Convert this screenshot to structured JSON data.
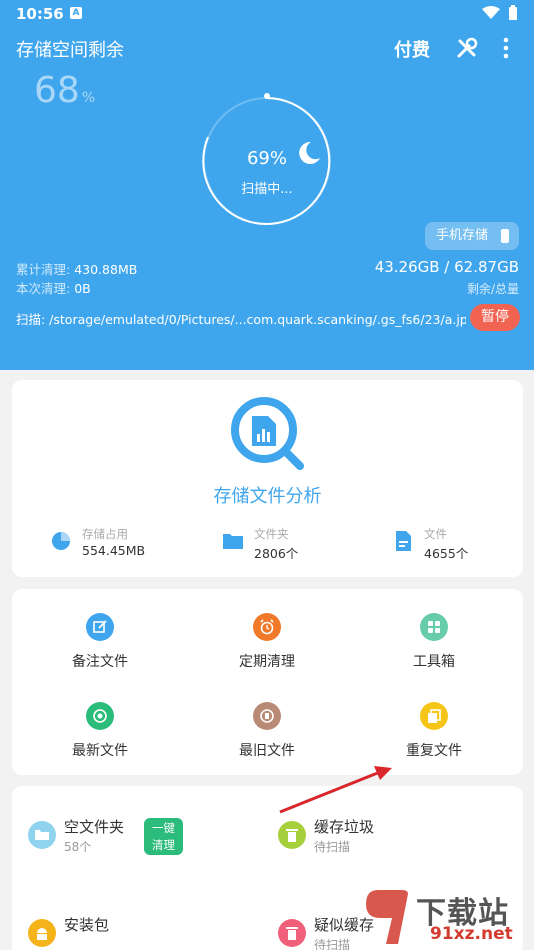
{
  "status_bar": {
    "time": "10:56",
    "notification_icon": "a-letter-icon"
  },
  "header": {
    "title": "存储空间剩余",
    "pay_label": "付费",
    "remaining_percent": "68",
    "percent_unit": "%",
    "scan_percent": "69%",
    "scan_status": "扫描中...",
    "storage_button": "手机存储",
    "cleaned_total_label": "累计清理:",
    "cleaned_total_value": "430.88MB",
    "cleaned_this_label": "本次清理:",
    "cleaned_this_value": "0B",
    "size_ratio": "43.26GB / 62.87GB",
    "size_caption": "剩余/总量",
    "scan_path": "扫描: /storage/emulated/0/Pictures/...com.quark.scanking/.gs_fs6/23/a.jpg",
    "pause_label": "暂停",
    "colors": {
      "primary": "#3fa6ee",
      "pause": "#f26451"
    }
  },
  "analysis": {
    "title": "存储文件分析",
    "stats": [
      {
        "label": "存储占用",
        "value": "554.45MB",
        "icon": "pie-chart-icon"
      },
      {
        "label": "文件夹",
        "value": "2806个",
        "icon": "folder-icon"
      },
      {
        "label": "文件",
        "value": "4655个",
        "icon": "file-icon"
      }
    ]
  },
  "tools": [
    {
      "label": "备注文件",
      "icon": "edit-note-icon",
      "color": "#3fa6ee"
    },
    {
      "label": "定期清理",
      "icon": "alarm-clock-icon",
      "color": "#f07a2a"
    },
    {
      "label": "工具箱",
      "icon": "toolbox-icon",
      "color": "#66ccaa"
    },
    {
      "label": "最新文件",
      "icon": "new-file-icon",
      "color": "#2bbb7a"
    },
    {
      "label": "最旧文件",
      "icon": "old-file-icon",
      "color": "#b98a76"
    },
    {
      "label": "重复文件",
      "icon": "duplicate-file-icon",
      "color": "#f5c518"
    }
  ],
  "cleaning": {
    "empty_folder": {
      "name": "空文件夹",
      "count": "58个",
      "icon": "folder-open-icon",
      "color": "#8fd3ee"
    },
    "one_click_line1": "一键",
    "one_click_line2": "清理",
    "cache_junk": {
      "name": "缓存垃圾",
      "status": "待扫描",
      "icon": "trash-icon",
      "color": "#a6cf3c"
    },
    "apk": {
      "name": "安装包",
      "icon": "android-icon",
      "color": "#f5b31a"
    },
    "suspicious_cache": {
      "name": "疑似缓存",
      "status": "待扫描",
      "icon": "trash-icon",
      "color": "#f0607a"
    }
  },
  "watermark": {
    "main": "下载站",
    "sub": "91xz.net"
  }
}
